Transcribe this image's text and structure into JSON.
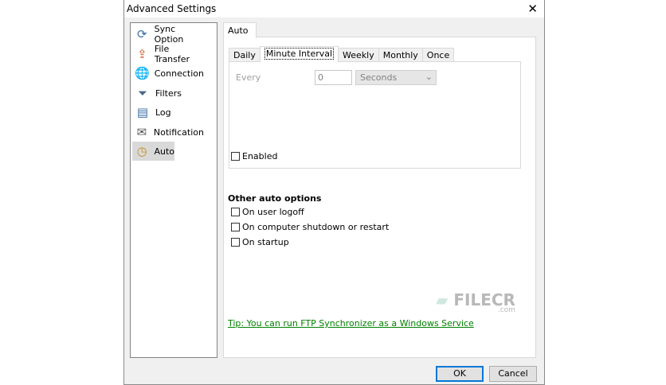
{
  "window": {
    "title": "Advanced Settings"
  },
  "sidebar": {
    "items": [
      {
        "label": "Sync Option",
        "icon": "sync-icon"
      },
      {
        "label": "File Transfer",
        "icon": "file-transfer-icon"
      },
      {
        "label": "Connection",
        "icon": "globe-icon"
      },
      {
        "label": "Filters",
        "icon": "funnel-icon"
      },
      {
        "label": "Log",
        "icon": "log-icon"
      },
      {
        "label": "Notification",
        "icon": "envelope-icon"
      },
      {
        "label": "Auto",
        "icon": "clock-icon",
        "selected": true
      }
    ]
  },
  "outer_tab": "Auto",
  "inner_tabs": [
    "Daily",
    "Minute Interval",
    "Weekly",
    "Monthly",
    "Once"
  ],
  "interval": {
    "every_label": "Every",
    "value": "0",
    "unit": "Seconds",
    "enabled_label": "Enabled"
  },
  "other": {
    "heading": "Other auto options",
    "options": [
      "On user logoff",
      "On computer shutdown or restart",
      "On startup"
    ]
  },
  "tip": "Tip: You can run FTP Synchronizer as a Windows Service",
  "buttons": {
    "ok": "OK",
    "cancel": "Cancel"
  },
  "watermark": {
    "text": "FILECR",
    "sub": ".com"
  }
}
